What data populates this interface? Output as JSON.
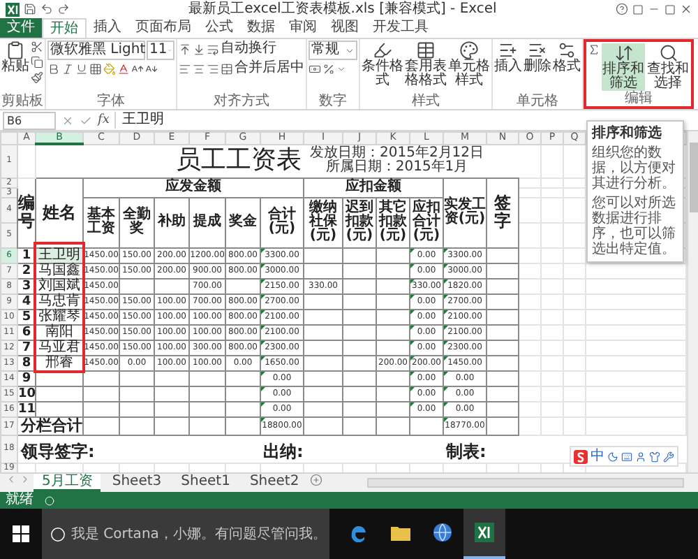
{
  "window": {
    "title": "最新员工excel工资表模板.xls [兼容模式] - Excel"
  },
  "ribbon_tabs": [
    {
      "label": "文件",
      "kind": "file",
      "selected": false
    },
    {
      "label": "开始",
      "kind": "tab",
      "selected": true
    },
    {
      "label": "插入",
      "kind": "tab",
      "selected": false
    },
    {
      "label": "页面布局",
      "kind": "tab",
      "selected": false
    },
    {
      "label": "公式",
      "kind": "tab",
      "selected": false
    },
    {
      "label": "数据",
      "kind": "tab",
      "selected": false
    },
    {
      "label": "审阅",
      "kind": "tab",
      "selected": false
    },
    {
      "label": "视图",
      "kind": "tab",
      "selected": false
    },
    {
      "label": "开发工具",
      "kind": "tab",
      "selected": false
    }
  ],
  "ribbon_groups": [
    {
      "kind": "clipboard",
      "label": "剪贴板",
      "buttons": [
        {
          "label": "粘贴"
        }
      ]
    },
    {
      "kind": "font",
      "label": "字体",
      "font_name": "微软雅黑 Light",
      "font_size": "11"
    },
    {
      "kind": "alignment",
      "label": "对齐方式",
      "buttons": [
        {
          "label": "自动换行"
        },
        {
          "label": "合并后居中"
        }
      ]
    },
    {
      "kind": "number",
      "label": "数字",
      "format": "常规"
    },
    {
      "kind": "styles",
      "label": "样式",
      "buttons": [
        {
          "label": "条件格式"
        },
        {
          "label": "套用表格格式"
        },
        {
          "label": "单元格样式"
        }
      ]
    },
    {
      "kind": "cells",
      "label": "单元格",
      "buttons": [
        {
          "label": "插入"
        },
        {
          "label": "删除"
        },
        {
          "label": "格式"
        }
      ]
    },
    {
      "kind": "editing",
      "label": "编辑",
      "highlighted": true,
      "buttons": [
        {
          "label": "排序和筛选",
          "active": true
        },
        {
          "label": "查找和选择",
          "active": false
        }
      ]
    }
  ],
  "formula_bar": {
    "cell": "B6",
    "function_label": "fx",
    "value": "王卫明"
  },
  "tooltip": {
    "title": "排序和筛选",
    "paragraphs": [
      "组织您的数据，以方便对其进行分析。",
      "您可以对所选数据进行排序，也可以筛选出特定值。"
    ]
  },
  "sheet": {
    "column_letters": [
      "A",
      "B",
      "C",
      "D",
      "E",
      "F",
      "G",
      "H",
      "I",
      "J",
      "K",
      "L",
      "M",
      "N",
      "O",
      "P",
      "Q"
    ],
    "row_numbers": [
      "1",
      "2",
      "3",
      "4",
      "5",
      "6",
      "7",
      "8",
      "9",
      "10",
      "11",
      "12",
      "13",
      "14",
      "15",
      "16",
      "17",
      "18",
      "19"
    ],
    "title": "员工工资表",
    "issue_date": "发放日期：2015年2月12日",
    "period": "所属日期：2015年1月",
    "header": [
      {
        "kind": "single",
        "label": "编号",
        "emphasis": true
      },
      {
        "kind": "single",
        "label": "姓名",
        "emphasis": true
      },
      {
        "kind": "group",
        "label": "应发金额",
        "columns": [
          {
            "label": "基本工资",
            "flagged": false
          },
          {
            "label": "全勤奖",
            "flagged": false
          },
          {
            "label": "补助",
            "flagged": false
          },
          {
            "label": "提成",
            "flagged": false
          },
          {
            "label": "奖金",
            "flagged": false
          },
          {
            "label": "合计(元)",
            "flagged": true
          }
        ]
      },
      {
        "kind": "group",
        "label": "应扣金额",
        "columns": [
          {
            "label": "缴纳社保(元)",
            "flagged": false
          },
          {
            "label": "迟到扣款(元)"
          },
          {
            "label": "其它扣款(元)",
            "flagged": false
          },
          {
            "label": "应扣合计(元)",
            "flagged": true
          }
        ]
      },
      {
        "kind": "single",
        "label": "实发工资(元)",
        "emphasis": false,
        "flagged": true
      },
      {
        "kind": "single",
        "label": "签字",
        "emphasis": true
      }
    ],
    "rows": [
      {
        "no": "1",
        "name": "王卫明",
        "selected": true,
        "values": {
          "C": "1450.00",
          "D": "150.00",
          "E": "200.00",
          "F": "1200.00",
          "G": "800.00",
          "H": "3300.00",
          "L": "0.00",
          "M": "3300.00"
        }
      },
      {
        "no": "2",
        "name": "马国鑫",
        "selected": false,
        "values": {
          "C": "1450.00",
          "D": "150.00",
          "E": "200.00",
          "F": "900.00",
          "G": "800.00",
          "H": "3000.00",
          "L": "0.00",
          "M": "3000.00"
        }
      },
      {
        "no": "3",
        "name": "刘国斌",
        "selected": false,
        "values": {
          "C": "1450.00",
          "F": "700.00",
          "H": "2150.00",
          "I": "330.00",
          "L": "330.00",
          "M": "1820.00"
        }
      },
      {
        "no": "4",
        "name": "马忠肯",
        "selected": false,
        "values": {
          "C": "1450.00",
          "D": "150.00",
          "E": "100.00",
          "F": "700.00",
          "G": "800.00",
          "H": "2700.00",
          "L": "0.00",
          "M": "2700.00"
        }
      },
      {
        "no": "5",
        "name": "张耀琴",
        "selected": false,
        "values": {
          "C": "1450.00",
          "D": "150.00",
          "E": "100.00",
          "F": "100.00",
          "G": "800.00",
          "H": "2100.00",
          "L": "0.00",
          "M": "2100.00"
        }
      },
      {
        "no": "6",
        "name": "南阳",
        "selected": false,
        "values": {
          "C": "1450.00",
          "D": "150.00",
          "E": "100.00",
          "F": "100.00",
          "G": "800.00",
          "H": "2100.00",
          "L": "0.00",
          "M": "2100.00"
        }
      },
      {
        "no": "7",
        "name": "马亚君",
        "selected": false,
        "values": {
          "C": "1450.00",
          "D": "150.00",
          "E": "100.00",
          "F": "300.00",
          "G": "800.00",
          "H": "2300.00",
          "L": "0.00",
          "M": "2300.00"
        }
      },
      {
        "no": "8",
        "name": "邢睿",
        "selected": false,
        "values": {
          "C": "1450.00",
          "D": "0.00",
          "E": "100.00",
          "F": "100.00",
          "G": "0.00",
          "H": "1650.00",
          "K": "200.00",
          "L": "200.00",
          "M": "1450.00"
        }
      },
      {
        "no": "9",
        "selected": false,
        "values": {
          "H": "0.00",
          "L": "0.00",
          "M": "0.00"
        }
      },
      {
        "no": "10",
        "selected": false,
        "values": {
          "H": "0.00",
          "L": "0.00",
          "M": "0.00"
        }
      },
      {
        "no": "11",
        "selected": false,
        "values": {
          "H": "0.00",
          "L": "0.00",
          "M": "0.00"
        }
      }
    ],
    "total": {
      "label": "分栏合计",
      "values": {
        "H": "18800.00",
        "M": "18770.00"
      }
    },
    "footer": [
      "领导签字:",
      "出纳:",
      "制表:"
    ],
    "names_highlighted": true
  },
  "sheet_tabs": [
    {
      "label": "5月工资",
      "selected": true
    },
    {
      "label": "Sheet3",
      "selected": false
    },
    {
      "label": "Sheet1",
      "selected": false
    },
    {
      "label": "Sheet2",
      "selected": false
    }
  ],
  "status_bar": {
    "text": "就绪"
  },
  "ime_bar": {
    "mode": "中"
  },
  "taskbar": {
    "placeholder": "我是 Cortana，小娜。有问题尽管问我。",
    "apps": [
      {
        "kind": "edge",
        "selected": false
      },
      {
        "kind": "explorer",
        "selected": false
      },
      {
        "kind": "globe",
        "selected": false
      },
      {
        "kind": "excel",
        "selected": true
      }
    ]
  }
}
